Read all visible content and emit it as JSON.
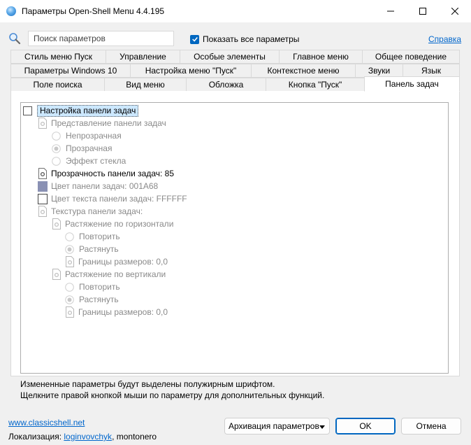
{
  "window": {
    "title": "Параметры Open-Shell Menu 4.4.195"
  },
  "search": {
    "placeholder": "Поиск параметров"
  },
  "show_all_label": "Показать все параметры",
  "help_label": "Справка",
  "tabs": {
    "row1": [
      "Стиль меню Пуск",
      "Управление",
      "Особые элементы",
      "Главное меню",
      "Общее поведение"
    ],
    "row2": [
      "Параметры Windows 10",
      "Настройка меню \"Пуск\"",
      "Контекстное меню",
      "Звуки",
      "Язык"
    ],
    "row3": [
      "Поле поиска",
      "Вид меню",
      "Обложка",
      "Кнопка \"Пуск\"",
      "Панель задач"
    ]
  },
  "tree": {
    "root": "Настройка панели задач",
    "look": "Представление панели задач",
    "opaque": "Непрозрачная",
    "transparent": "Прозрачная",
    "glass": "Эффект стекла",
    "opacity": "Прозрачность панели задач: 85",
    "color": "Цвет панели задач: 001A68",
    "text_color": "Цвет текста панели задач: FFFFFF",
    "texture": "Текстура панели задач:",
    "stretch_h": "Растяжение по горизонтали",
    "repeat_h": "Повторить",
    "stretch_h_opt": "Растянуть",
    "borders_h": "Границы размеров: 0,0",
    "stretch_v": "Растяжение по вертикали",
    "repeat_v": "Повторить",
    "stretch_v_opt": "Растянуть",
    "borders_v": "Границы размеров: 0,0"
  },
  "info": {
    "line1": "Измененные параметры будут выделены полужирным шрифтом.",
    "line2": "Щелкните правой кнопкой мыши по параметру для дополнительных функций."
  },
  "footer": {
    "site": "www.classicshell.net",
    "loc_prefix": "Локализация: ",
    "loc_link": "loginvovchyk",
    "loc_suffix": ", montonero",
    "backup": "Архивация параметров",
    "ok": "OK",
    "cancel": "Отмена"
  },
  "colors": {
    "accent": "#0067c0",
    "link": "#0066cc",
    "taskbar_swatch": "#8a91b4"
  }
}
